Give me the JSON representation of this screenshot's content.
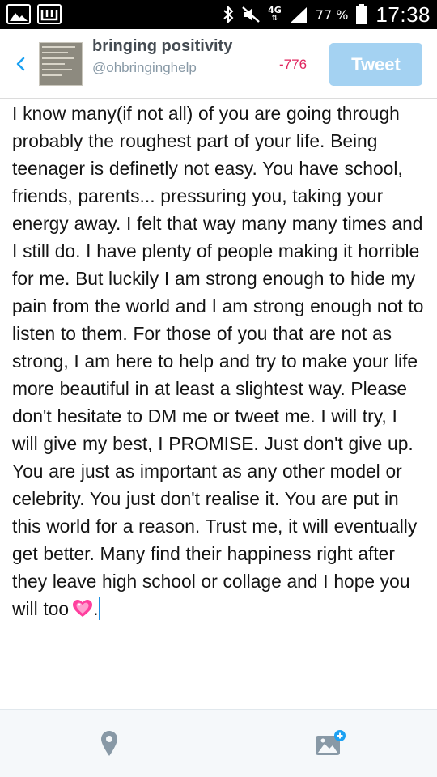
{
  "status_bar": {
    "battery_percent": "77 %",
    "time": "17:38",
    "network": "4G",
    "icons": [
      "gallery-icon",
      "whatsapp-icon",
      "bluetooth-icon",
      "mute-icon",
      "signal-icon",
      "battery-icon"
    ]
  },
  "header": {
    "back_icon": "chevron-left-icon",
    "account_name": "bringing positivity",
    "account_handle": "@ohbringinghelp",
    "char_counter": "-776",
    "tweet_label": "Tweet"
  },
  "compose": {
    "text": "I know many(if not all) of you are going through probably the roughest part of your life. Being teenager is definetly not easy. You have school, friends, parents... pressuring you, taking your energy away. I felt that way many many times and I still do. I have plenty of people making it horrible for me. But luckily I am strong enough to hide my pain from the world and I am strong enough not to listen to them. For those of you that are not as strong, I am here to help and try to make your life more beautiful in at least a slightest way. Please don't hesitate to DM me or tweet me. I will try, I will give my best, I PROMISE. Just don't give up. You are just as important as any other model or celebrity. You just don't realise it. You are put in this world for a reason. Trust me, it will eventually get better. Many find their happiness right after they leave high school or collage and I hope you will too",
    "emoji_icon": "sparkling-heart-icon",
    "trailing_text": "."
  },
  "toolbar": {
    "location_icon": "location-pin-icon",
    "media_icon": "add-photo-icon"
  },
  "colors": {
    "tweet_button": "#a4d2f2",
    "counter": "#e0245e",
    "caret": "#1d8fe0",
    "toolbar_bg": "#f5f8fa"
  }
}
